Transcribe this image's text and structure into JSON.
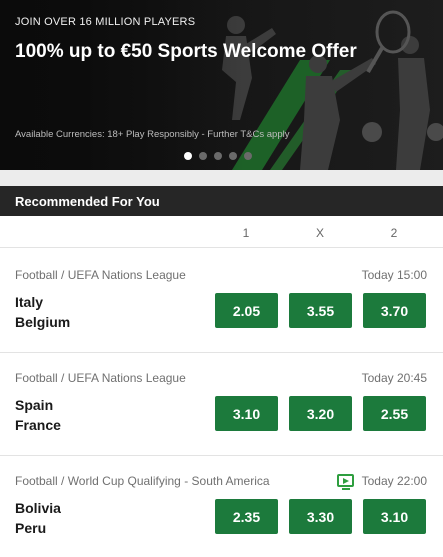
{
  "hero": {
    "kicker": "JOIN OVER 16 MILLION PLAYERS",
    "title": "100% up to €50 Sports Welcome Offer",
    "terms": "Available Currencies: 18+ Play Responsibly - Further T&Cs apply",
    "slides": 5,
    "active_slide": 1
  },
  "section": {
    "title": "Recommended For You",
    "columns": [
      "1",
      "X",
      "2"
    ]
  },
  "events": [
    {
      "competition": "Football / UEFA Nations League",
      "time": "Today 15:00",
      "live_stream": false,
      "home": "Italy",
      "away": "Belgium",
      "odds": [
        "2.05",
        "3.55",
        "3.70"
      ]
    },
    {
      "competition": "Football / UEFA Nations League",
      "time": "Today 20:45",
      "live_stream": false,
      "home": "Spain",
      "away": "France",
      "odds": [
        "3.10",
        "3.20",
        "2.55"
      ]
    },
    {
      "competition": "Football / World Cup Qualifying - South America",
      "time": "Today 22:00",
      "live_stream": true,
      "live_stream_icon": "tv-play-icon",
      "home": "Bolivia",
      "away": "Peru",
      "odds": [
        "2.35",
        "3.30",
        "3.10"
      ]
    }
  ],
  "colors": {
    "odds_button": "#1c7a3c",
    "section_bar": "#262626",
    "stream_icon": "#2e9e3f",
    "hero_accent": "#1f6f2a"
  }
}
